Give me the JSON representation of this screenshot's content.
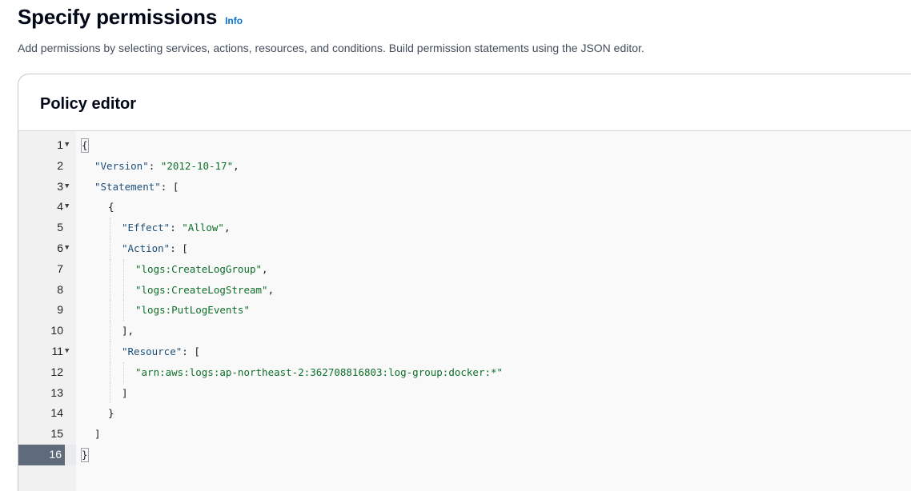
{
  "header": {
    "title": "Specify permissions",
    "info_label": "Info",
    "description": "Add permissions by selecting services, actions, resources, and conditions. Build permission statements using the JSON editor."
  },
  "panel": {
    "title": "Policy editor"
  },
  "editor": {
    "active_line": 16,
    "lines": [
      {
        "n": "1",
        "fold": true,
        "indent": 0,
        "tokens": [
          [
            "punc",
            "{"
          ]
        ]
      },
      {
        "n": "2",
        "fold": false,
        "indent": 1,
        "tokens": [
          [
            "key",
            "\"Version\""
          ],
          [
            "punc",
            ": "
          ],
          [
            "str",
            "\"2012-10-17\""
          ],
          [
            "punc",
            ","
          ]
        ]
      },
      {
        "n": "3",
        "fold": true,
        "indent": 1,
        "tokens": [
          [
            "key",
            "\"Statement\""
          ],
          [
            "punc",
            ": ["
          ]
        ]
      },
      {
        "n": "4",
        "fold": true,
        "indent": 2,
        "tokens": [
          [
            "punc",
            "{"
          ]
        ]
      },
      {
        "n": "5",
        "fold": false,
        "indent": 3,
        "tokens": [
          [
            "key",
            "\"Effect\""
          ],
          [
            "punc",
            ": "
          ],
          [
            "str",
            "\"Allow\""
          ],
          [
            "punc",
            ","
          ]
        ]
      },
      {
        "n": "6",
        "fold": true,
        "indent": 3,
        "tokens": [
          [
            "key",
            "\"Action\""
          ],
          [
            "punc",
            ": ["
          ]
        ]
      },
      {
        "n": "7",
        "fold": false,
        "indent": 4,
        "tokens": [
          [
            "str",
            "\"logs:CreateLogGroup\""
          ],
          [
            "punc",
            ","
          ]
        ]
      },
      {
        "n": "8",
        "fold": false,
        "indent": 4,
        "tokens": [
          [
            "str",
            "\"logs:CreateLogStream\""
          ],
          [
            "punc",
            ","
          ]
        ]
      },
      {
        "n": "9",
        "fold": false,
        "indent": 4,
        "tokens": [
          [
            "str",
            "\"logs:PutLogEvents\""
          ]
        ]
      },
      {
        "n": "10",
        "fold": false,
        "indent": 3,
        "tokens": [
          [
            "punc",
            "],"
          ]
        ]
      },
      {
        "n": "11",
        "fold": true,
        "indent": 3,
        "tokens": [
          [
            "key",
            "\"Resource\""
          ],
          [
            "punc",
            ": ["
          ]
        ]
      },
      {
        "n": "12",
        "fold": false,
        "indent": 4,
        "tokens": [
          [
            "str",
            "\"arn:aws:logs:ap-northeast-2:362708816803:log-group:docker:*\""
          ]
        ]
      },
      {
        "n": "13",
        "fold": false,
        "indent": 3,
        "tokens": [
          [
            "punc",
            "]"
          ]
        ]
      },
      {
        "n": "14",
        "fold": false,
        "indent": 2,
        "tokens": [
          [
            "punc",
            "}"
          ]
        ]
      },
      {
        "n": "15",
        "fold": false,
        "indent": 1,
        "tokens": [
          [
            "punc",
            "]"
          ]
        ]
      },
      {
        "n": "16",
        "fold": false,
        "indent": 0,
        "tokens": [
          [
            "punc",
            "}"
          ]
        ]
      }
    ]
  }
}
